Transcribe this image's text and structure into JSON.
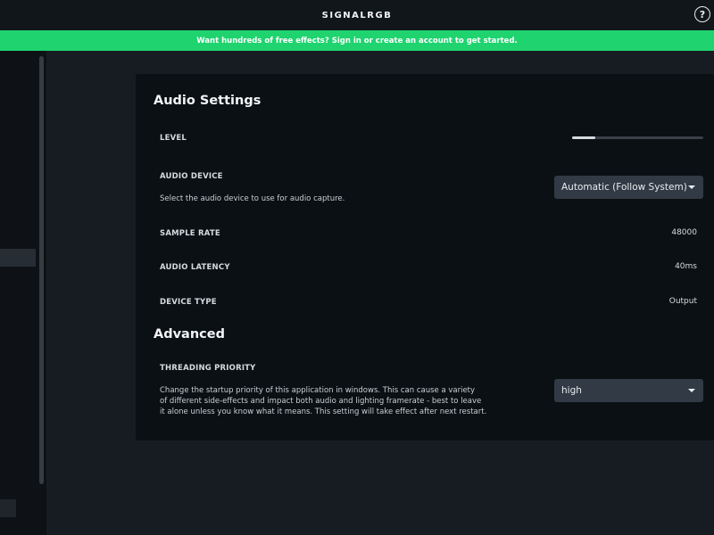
{
  "titlebar": {
    "logo_text": "SIGNALRGB",
    "help_label": "?"
  },
  "banner": {
    "text": "Want hundreds of free effects? Sign in or create an account to get started."
  },
  "audio_settings": {
    "title": "Audio Settings",
    "level": {
      "label": "LEVEL",
      "value_fraction": 0.18
    },
    "audio_device": {
      "label": "AUDIO DEVICE",
      "description": "Select the audio device to use for audio capture.",
      "selected": "Automatic (Follow System)"
    },
    "sample_rate": {
      "label": "SAMPLE RATE",
      "value": "48000"
    },
    "audio_latency": {
      "label": "AUDIO LATENCY",
      "value": "40ms"
    },
    "device_type": {
      "label": "DEVICE TYPE",
      "value": "Output"
    }
  },
  "advanced": {
    "title": "Advanced",
    "threading_priority": {
      "label": "THREADING PRIORITY",
      "description_lines": [
        "Change the startup priority of this application in windows.  This can cause a variety",
        "of different side-effects and impact both audio and lighting framerate - best to leave",
        "it alone unless you know what it means.  This setting will take effect after next restart."
      ],
      "selected": "high"
    }
  },
  "colors": {
    "banner": "#1fd36f",
    "panel": "#0b1014",
    "background": "#161c22",
    "dropdown": "#313a45"
  }
}
